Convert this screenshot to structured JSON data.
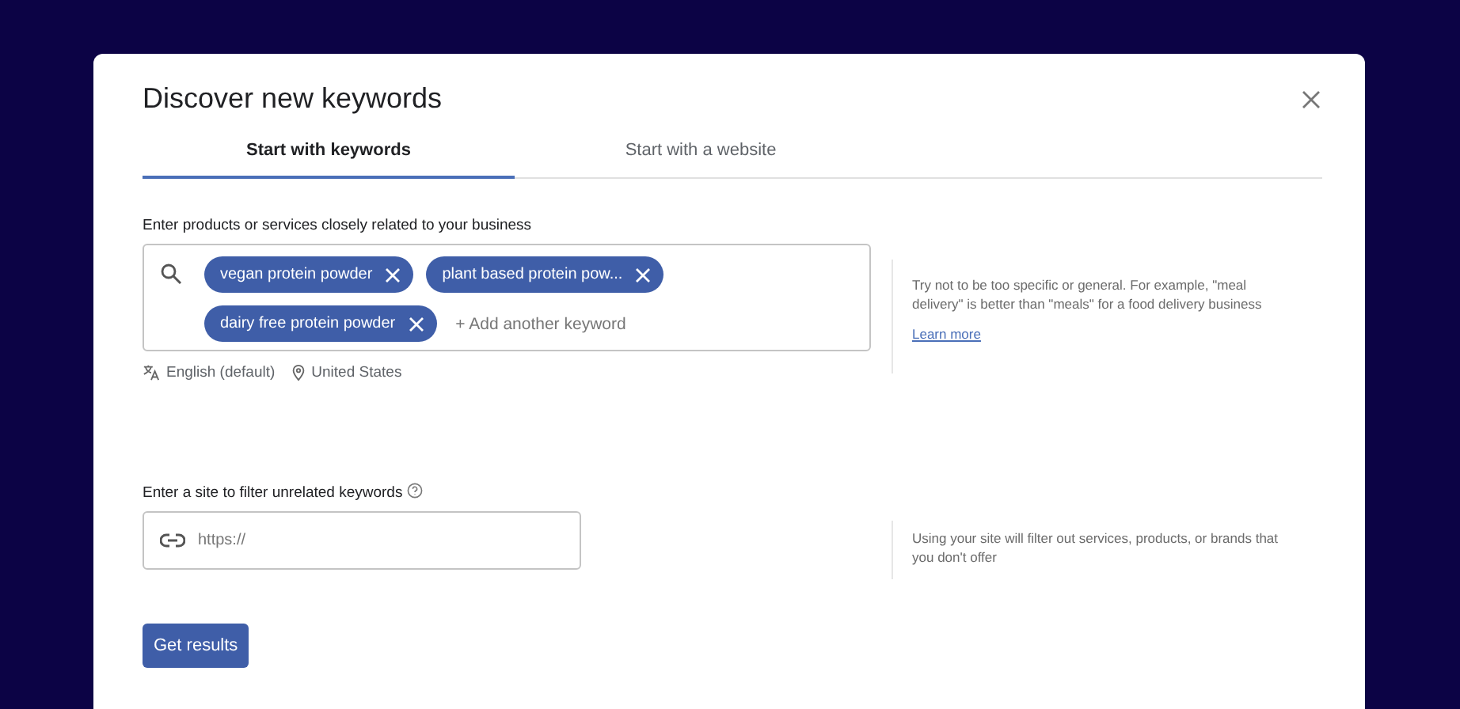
{
  "dialog": {
    "title": "Discover new keywords"
  },
  "tabs": [
    {
      "label": "Start with keywords",
      "selected": true
    },
    {
      "label": "Start with a website",
      "selected": false
    }
  ],
  "keywords_section": {
    "label": "Enter products or services closely related to your business",
    "chips": [
      "vegan protein powder",
      "plant based protein pow...",
      "dairy free protein powder"
    ],
    "placeholder": "+ Add another keyword",
    "language": "English (default)",
    "location": "United States",
    "hint": "Try not to be too specific or general. For example, \"meal delivery\" is better than \"meals\" for a food delivery business",
    "hint_link": "Learn more"
  },
  "site_section": {
    "label": "Enter a site to filter unrelated keywords",
    "placeholder": "https://",
    "hint": "Using your site will filter out services, products, or brands that you don't offer"
  },
  "primary_button": "Get results"
}
